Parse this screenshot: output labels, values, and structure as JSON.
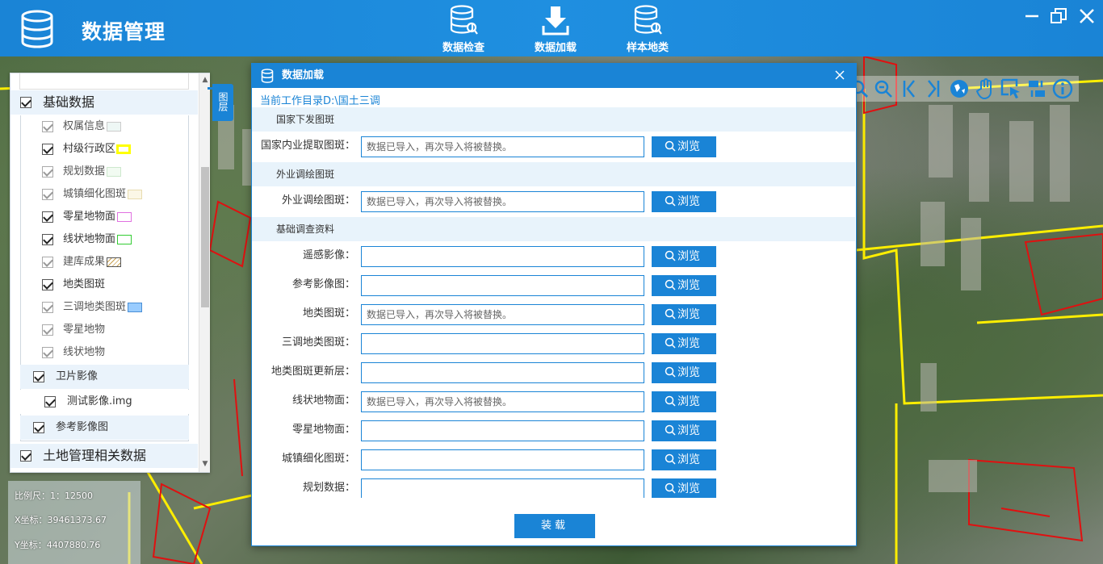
{
  "header": {
    "title": "数据管理",
    "nav": [
      {
        "label": "数据检查",
        "icon": "database-search-icon"
      },
      {
        "label": "数据加载",
        "icon": "download-icon"
      },
      {
        "label": "样本地类",
        "icon": "database-search-icon"
      }
    ]
  },
  "layer_panel": {
    "tab_label": "图层",
    "groups": [
      {
        "label": "基础数据",
        "checked": true
      },
      {
        "label": "土地管理相关数据",
        "checked": true
      }
    ],
    "items": [
      {
        "label": "权属信息",
        "checked": true,
        "enabled": false,
        "legend_color": "#e6f2ee"
      },
      {
        "label": "村级行政区",
        "checked": true,
        "enabled": true,
        "legend_color": "#ffff00"
      },
      {
        "label": "规划数据",
        "checked": true,
        "enabled": false,
        "legend_color": "#e0f5e0"
      },
      {
        "label": "城镇细化图斑",
        "checked": true,
        "enabled": false,
        "legend_color": "#f7f0d0"
      },
      {
        "label": "零星地物面",
        "checked": true,
        "enabled": true,
        "legend_color": "#e070e0"
      },
      {
        "label": "线状地物面",
        "checked": true,
        "enabled": true,
        "legend_color": "#33cc33"
      },
      {
        "label": "建库成果",
        "checked": true,
        "enabled": false,
        "legend_color": "hatched"
      },
      {
        "label": "地类图斑",
        "checked": true,
        "enabled": true,
        "legend_color": ""
      },
      {
        "label": "三调地类图斑",
        "checked": true,
        "enabled": false,
        "legend_color": "#99ccff"
      },
      {
        "label": "零星地物",
        "checked": true,
        "enabled": false,
        "legend_color": ""
      },
      {
        "label": "线状地物",
        "checked": true,
        "enabled": false,
        "legend_color": ""
      }
    ],
    "sub_items": [
      {
        "label": "卫片影像",
        "checked": true
      },
      {
        "label": "测试影像.img",
        "checked": true
      },
      {
        "label": "参考影像图",
        "checked": true
      }
    ]
  },
  "status": {
    "scale": "比例尺：1：12500",
    "x": "X坐标：39461373.67",
    "y": "Y坐标：4407880.76"
  },
  "map_tools": [
    "zoom-in-icon",
    "zoom-out-icon",
    "previous-extent-icon",
    "next-extent-icon",
    "globe-icon",
    "pan-hand-icon",
    "select-icon",
    "swap-icon",
    "info-icon"
  ],
  "dialog": {
    "title": "数据加载",
    "cwd": "当前工作目录D:\\国土三调",
    "browse_label": "浏览",
    "load_label": "装载",
    "sections": [
      {
        "title": "国家下发图斑",
        "rows": [
          {
            "label": "国家内业提取图斑：",
            "value": "数据已导入，再次导入将被替换。"
          }
        ]
      },
      {
        "title": "外业调绘图斑",
        "rows": [
          {
            "label": "外业调绘图斑：",
            "value": "数据已导入，再次导入将被替换。"
          }
        ]
      },
      {
        "title": "基础调查资料",
        "rows": [
          {
            "label": "遥感影像：",
            "value": ""
          },
          {
            "label": "参考影像图：",
            "value": ""
          },
          {
            "label": "地类图斑：",
            "value": "数据已导入，再次导入将被替换。"
          },
          {
            "label": "三调地类图斑：",
            "value": ""
          },
          {
            "label": "地类图斑更新层：",
            "value": ""
          },
          {
            "label": "线状地物面：",
            "value": "数据已导入，再次导入将被替换。"
          },
          {
            "label": "零星地物面：",
            "value": ""
          },
          {
            "label": "城镇细化图斑：",
            "value": ""
          },
          {
            "label": "规划数据：",
            "value": ""
          }
        ]
      }
    ]
  }
}
